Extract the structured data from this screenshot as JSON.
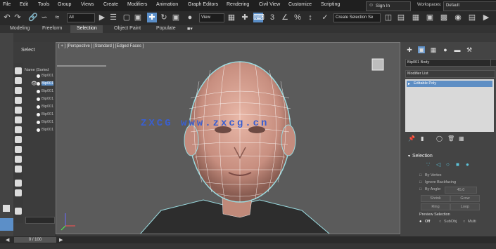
{
  "menu": [
    "File",
    "Edit",
    "Tools",
    "Group",
    "Views",
    "Create",
    "Modifiers",
    "Animation",
    "Graph Editors",
    "Rendering",
    "Civil View",
    "Customize",
    "Scripting"
  ],
  "signin": {
    "label": "Sign In"
  },
  "workspace": {
    "label": "Workspaces:",
    "value": "Default"
  },
  "toolbar": {
    "selection_filter": "All",
    "ref_coord": "View",
    "named_selection": "Create Selection Se"
  },
  "ribbon": {
    "tabs": [
      "Modeling",
      "Freeform",
      "Selection",
      "Object Paint",
      "Populate"
    ],
    "active": "Selection"
  },
  "explorer": {
    "title": "Select",
    "column": "Name (Sorted",
    "rows": [
      "Bip001",
      "Bip001",
      "Bip001",
      "Bip001",
      "Bip001",
      "Bip001",
      "Bip001",
      "Bip001"
    ]
  },
  "viewport": {
    "label": "[ + ] [Perspective ] [Standard ] [Edged Faces ]"
  },
  "command_panel": {
    "object_name": "Bip001 Body",
    "modifier_list": "Modifier List",
    "stack_item": "Editable Poly",
    "rollout_title": "Selection",
    "by_vertex": "By Vertex",
    "ignore_backfacing": "Ignore Backfacing",
    "by_angle": "By Angle:",
    "angle_value": "45.0",
    "shrink": "Shrink",
    "grow": "Grow",
    "ring": "Ring",
    "loop": "Loop",
    "preview_selection": "Preview Selection",
    "off": "Off",
    "subobj": "SubObj",
    "multi": "Multi"
  },
  "timeline": {
    "slider": "0 / 100"
  },
  "watermark": "ZXCG www.zxcg.cn"
}
